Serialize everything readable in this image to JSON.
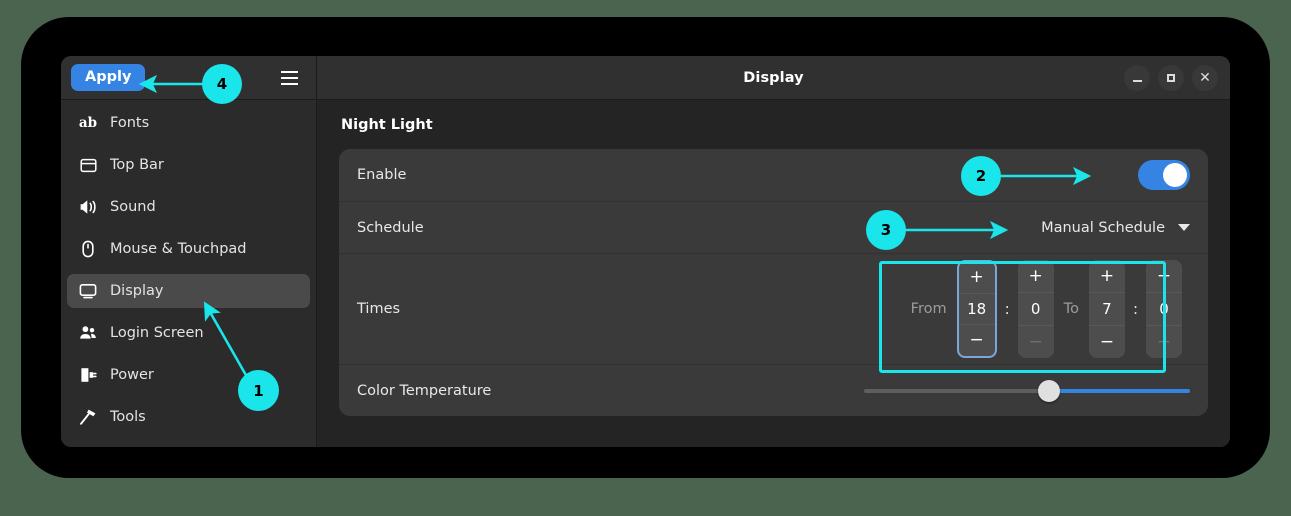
{
  "window": {
    "title": "Display",
    "apply_label": "Apply",
    "menu_icon": "hamburger-menu-icon",
    "controls": {
      "minimize": "minimize-icon",
      "maximize": "maximize-icon",
      "close": "✕"
    }
  },
  "sidebar": {
    "items": [
      {
        "label": "Fonts",
        "icon": "fonts-ab-icon",
        "selected": false
      },
      {
        "label": "Top Bar",
        "icon": "top-bar-icon",
        "selected": false
      },
      {
        "label": "Sound",
        "icon": "sound-speaker-icon",
        "selected": false
      },
      {
        "label": "Mouse & Touchpad",
        "icon": "mouse-icon",
        "selected": false
      },
      {
        "label": "Display",
        "icon": "display-monitor-icon",
        "selected": true
      },
      {
        "label": "Login Screen",
        "icon": "people-icon",
        "selected": false
      },
      {
        "label": "Power",
        "icon": "power-plug-icon",
        "selected": false
      },
      {
        "label": "Tools",
        "icon": "hammer-tools-icon",
        "selected": false
      }
    ]
  },
  "content": {
    "section_title": "Night Light",
    "enable": {
      "label": "Enable",
      "toggle_state": "on"
    },
    "schedule": {
      "label": "Schedule",
      "value": "Manual Schedule",
      "caret_icon": "chevron-down-icon"
    },
    "times": {
      "label": "Times",
      "from_word": "From",
      "to_word": "To",
      "separator": ":",
      "plus_label": "+",
      "minus_label": "−",
      "spinners": [
        {
          "name": "from-hours",
          "value": "18",
          "focused": true,
          "minus_dim": false
        },
        {
          "name": "from-minutes",
          "value": "0",
          "focused": false,
          "minus_dim": true
        },
        {
          "name": "to-hours",
          "value": "7",
          "focused": false,
          "minus_dim": false
        },
        {
          "name": "to-minutes",
          "value": "0",
          "focused": false,
          "minus_dim": true
        }
      ]
    },
    "color_temperature": {
      "label": "Color Temperature"
    }
  },
  "annotations": [
    {
      "number": "1",
      "target": "sidebar-item-display"
    },
    {
      "number": "2",
      "target": "enable-toggle"
    },
    {
      "number": "3",
      "target": "schedule-dropdown"
    },
    {
      "number": "4",
      "target": "apply-button"
    }
  ],
  "colors": {
    "accent": "#3584e4",
    "annotation": "#1ae5ea",
    "window_bg": "#242424",
    "card_bg": "#3a3a3a",
    "sidebar_bg": "#2b2b2b",
    "desktop_bg": "#4a6450"
  }
}
